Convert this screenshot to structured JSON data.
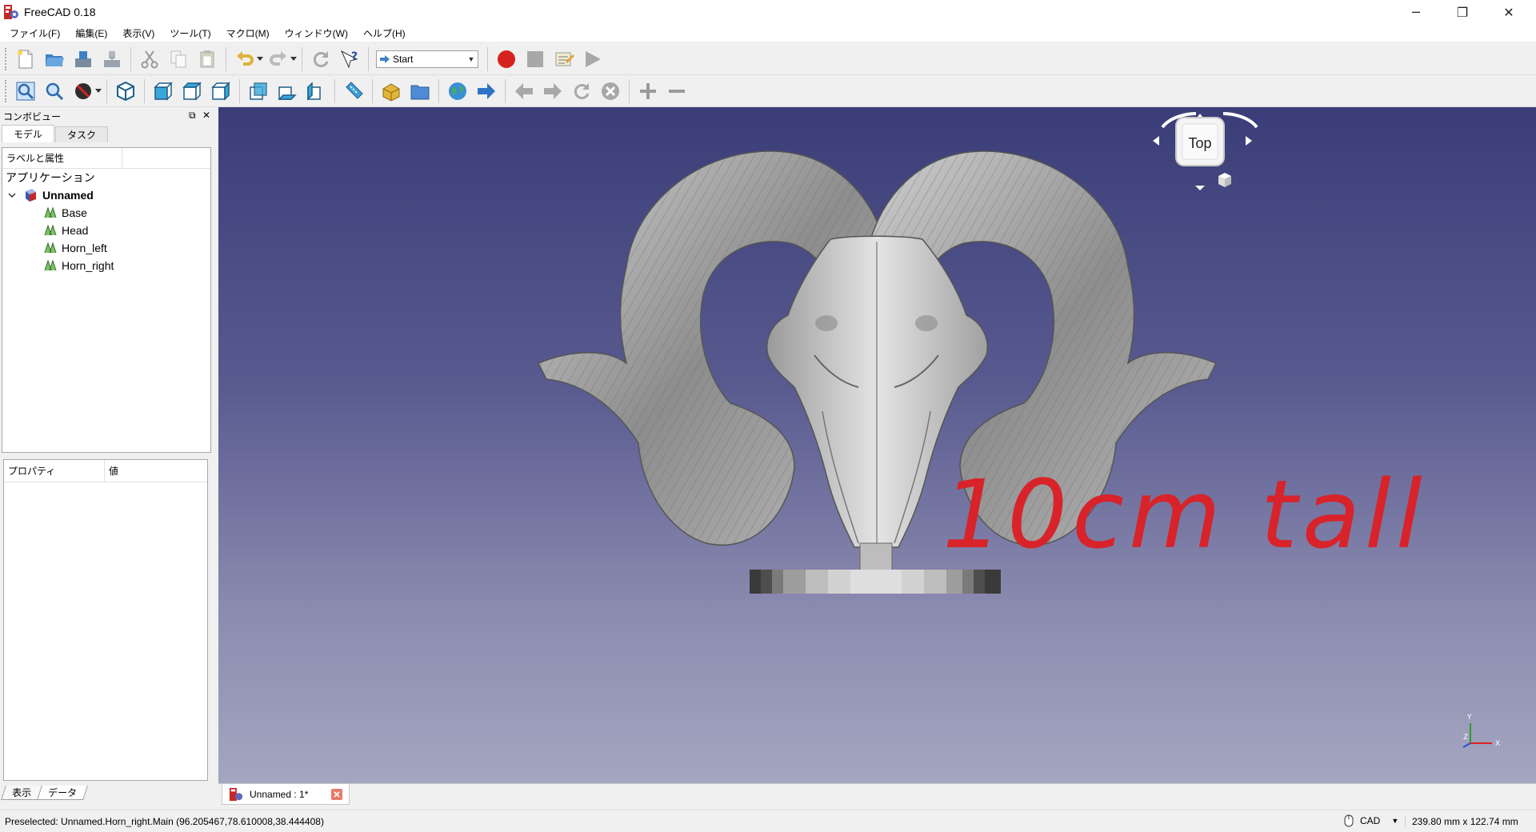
{
  "window": {
    "title": "FreeCAD 0.18",
    "minimize_glyph": "─",
    "maximize_glyph": "❐",
    "close_glyph": "✕"
  },
  "menu": [
    "ファイル(F)",
    "編集(E)",
    "表示(V)",
    "ツール(T)",
    "マクロ(M)",
    "ウィンドウ(W)",
    "ヘルプ(H)"
  ],
  "toolbar": {
    "workbench": "Start"
  },
  "combo_view": {
    "title": "コンボビュー",
    "tabs": [
      "モデル",
      "タスク"
    ],
    "tree_header": "ラベルと属性",
    "app_label": "アプリケーション",
    "document": "Unnamed",
    "items": [
      "Base",
      "Head",
      "Horn_left",
      "Horn_right"
    ],
    "prop_header": {
      "property": "プロパティ",
      "value": "値"
    },
    "bottom_tabs": [
      "表示",
      "データ"
    ]
  },
  "viewport": {
    "navcube_face": "Top",
    "annotation": "10cm tall",
    "annotation_color": "#d8232a",
    "axis": {
      "y": "Y",
      "z": "Z",
      "x": "X"
    }
  },
  "document_tab": {
    "label": "Unnamed : 1*"
  },
  "status": {
    "preselected": "Preselected: Unnamed.Horn_right.Main (96.205467,78.610008,38.444408)",
    "nav_style": "CAD",
    "dimensions": "239.80 mm x 122.74 mm"
  },
  "icons": [
    "freecad-logo-icon",
    "new-icon",
    "open-icon",
    "save-icon",
    "save-as-icon",
    "cut-icon",
    "copy-icon",
    "paste-icon",
    "undo-icon",
    "redo-icon",
    "refresh-icon",
    "whats-this-icon",
    "record-macro-icon",
    "stop-macro-icon",
    "edit-macro-icon",
    "run-macro-icon",
    "fit-all-icon",
    "fit-selection-icon",
    "draw-style-icon",
    "isometric-icon",
    "front-icon",
    "top-icon",
    "right-icon",
    "rear-icon",
    "bottom-icon",
    "left-icon",
    "measure-icon",
    "part-icon",
    "group-icon",
    "web-home-icon",
    "web-forward-icon",
    "web-back-icon",
    "web-next-icon",
    "web-refresh-icon",
    "web-stop-icon",
    "zoom-in-icon",
    "zoom-out-icon"
  ]
}
